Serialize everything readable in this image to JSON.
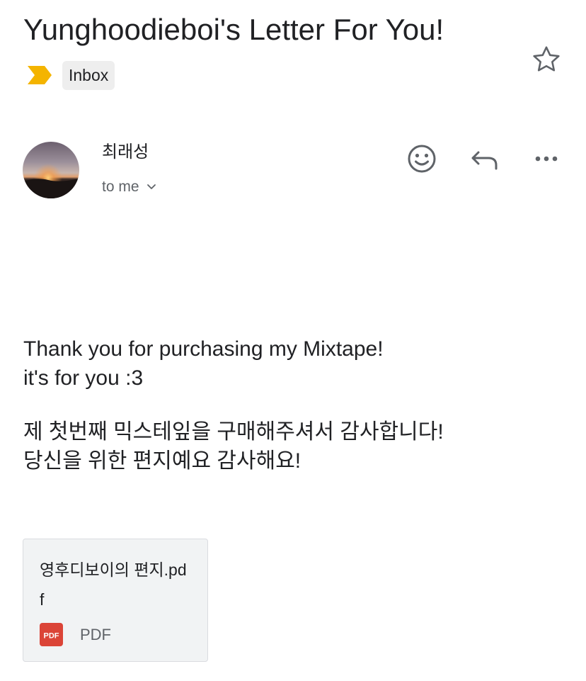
{
  "email": {
    "subject": "Yunghoodieboi's Letter For You!",
    "label": "Inbox",
    "sender": {
      "name": "최래성"
    },
    "recipient": "to me",
    "body": {
      "line1": "Thank you for purchasing my Mixtape!",
      "line2": "it's for you :3",
      "line3": "제 첫번째 믹스테잎을 구매해주셔서 감사합니다!",
      "line4": "당신을 위한 편지예요 감사해요!"
    },
    "attachment": {
      "filename": "영후디보이의 편지.pdf",
      "icon_text": "PDF",
      "type": "PDF"
    }
  },
  "icons": {
    "star": "star-outline-icon",
    "importance": "importance-marker-icon",
    "emoji": "smiley-icon",
    "reply": "reply-icon",
    "more": "more-horizontal-icon",
    "chevron": "chevron-down-icon",
    "pdf": "pdf-file-icon"
  },
  "colors": {
    "importance": "#f4b400",
    "pdf_icon": "#db4437",
    "attachment_bg": "#f1f3f4",
    "label_bg": "#eeeeee",
    "secondary_text": "#5f6368"
  }
}
